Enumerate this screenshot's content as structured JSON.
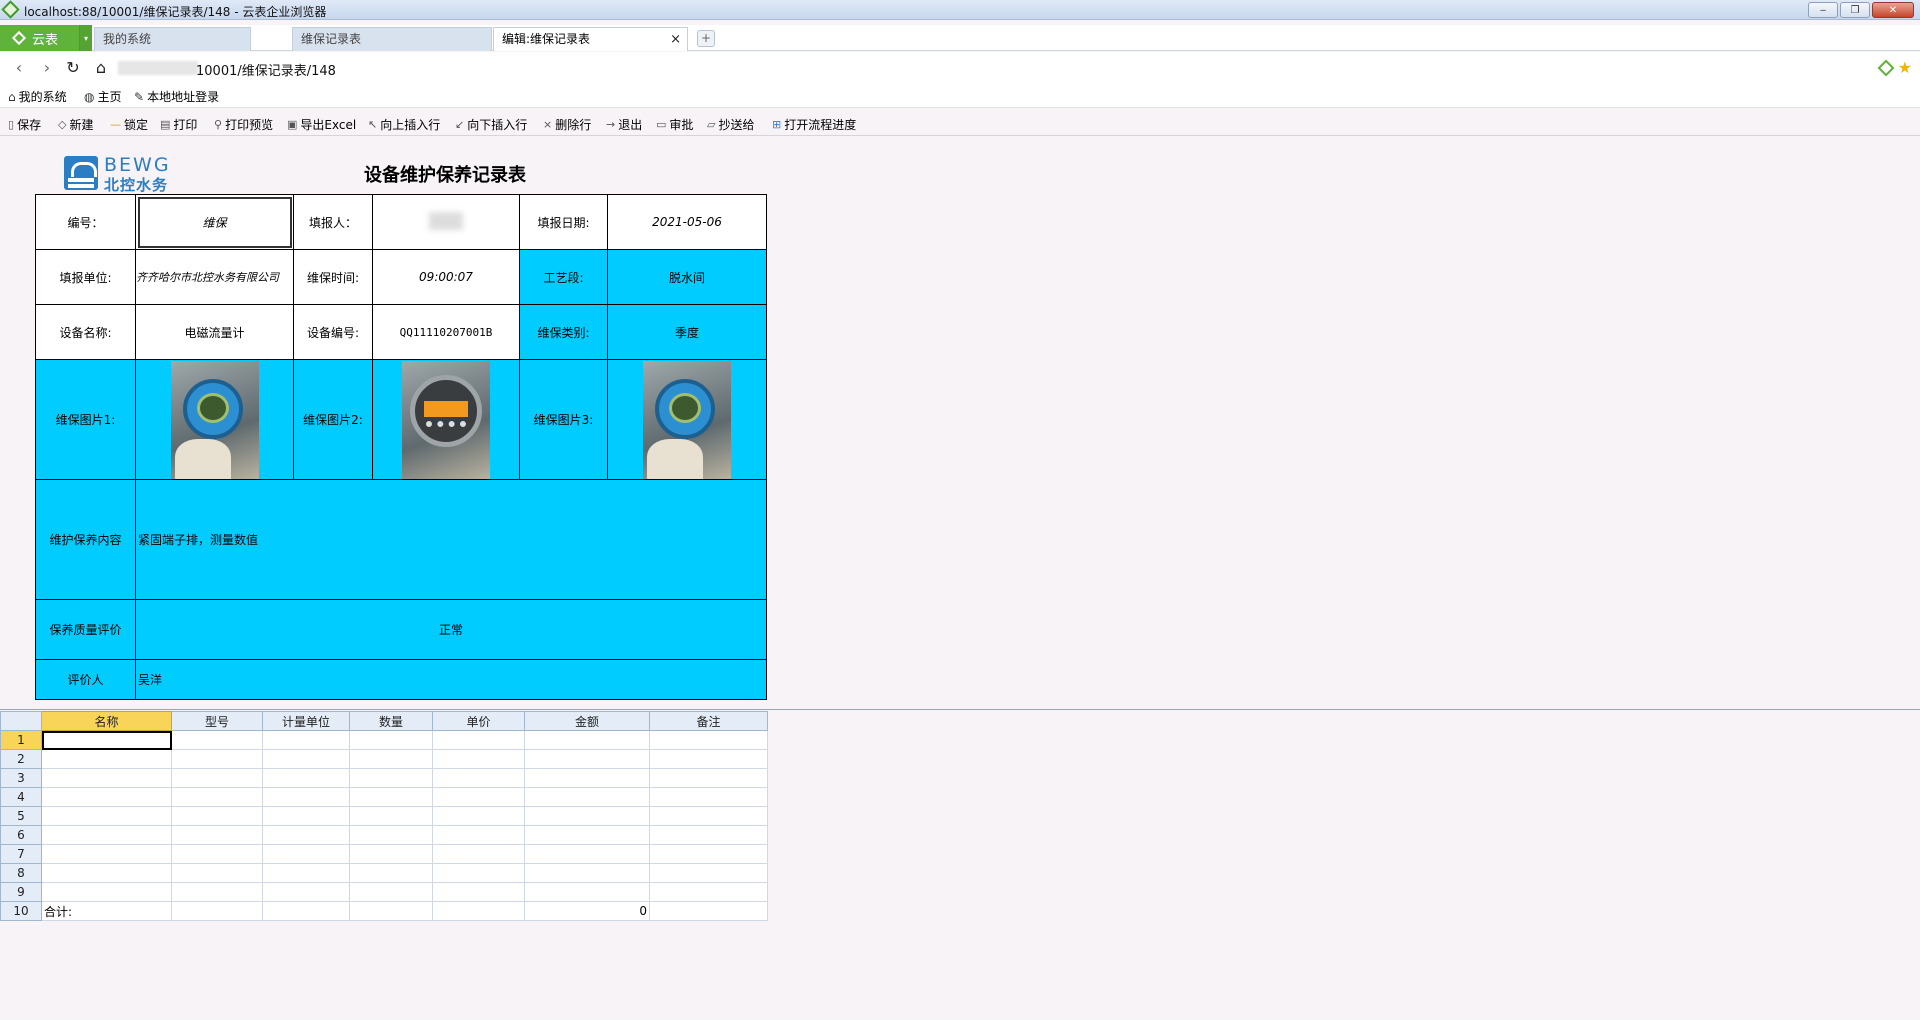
{
  "window": {
    "title": "localhost:88/10001/维保记录表/148 - 云表企业浏览器",
    "minimize": "‒",
    "restore": "❐",
    "close": "✕"
  },
  "tabs": {
    "brand": "云表",
    "brand_dropdown": "▾",
    "items": [
      {
        "label": "我的系统"
      },
      {
        "label": "维保记录表"
      },
      {
        "label": "编辑:维保记录表",
        "close": "×"
      }
    ],
    "new_tab": "+"
  },
  "address": {
    "url_visible": "10001/维保记录表/148"
  },
  "favorites": [
    {
      "label": "我的系统",
      "icon": "home-icon"
    },
    {
      "label": "主页",
      "icon": "globe-icon"
    },
    {
      "label": "本地地址登录",
      "icon": "wrench-icon"
    }
  ],
  "toolbar": [
    {
      "label": "保存",
      "icon": "save-icon"
    },
    {
      "label": "新建",
      "icon": "new-icon"
    },
    {
      "label": "锁定",
      "icon": "lock-icon"
    },
    {
      "label": "打印",
      "icon": "print-icon"
    },
    {
      "label": "打印预览",
      "icon": "print-preview-icon"
    },
    {
      "label": "导出Excel",
      "icon": "excel-icon"
    },
    {
      "label": "向上插入行",
      "icon": "insert-above-icon"
    },
    {
      "label": "向下插入行",
      "icon": "insert-below-icon"
    },
    {
      "label": "删除行",
      "icon": "delete-row-icon"
    },
    {
      "label": "退出",
      "icon": "exit-icon"
    },
    {
      "label": "审批",
      "icon": "approve-icon"
    },
    {
      "label": "抄送给",
      "icon": "cc-icon"
    },
    {
      "label": "打开流程进度",
      "icon": "flow-progress-icon"
    }
  ],
  "report": {
    "logo_en": "BEWG",
    "logo_cn": "北控水务",
    "title": "设备维护保养记录表",
    "labels": {
      "number": "编号：",
      "filler": "填报人：",
      "fill_date": "填报日期:",
      "unit": "填报单位:",
      "maint_time": "维保时间:",
      "process": "工艺段:",
      "device_name": "设备名称:",
      "device_no": "设备编号:",
      "maint_type": "维保类别:",
      "photo1": "维保图片1:",
      "photo2": "维保图片2:",
      "photo3": "维保图片3:",
      "content": "维护保养内容",
      "quality": "保养质量评价",
      "evaluator": "评价人"
    },
    "values": {
      "number": "维保",
      "fill_date": "2021-05-06",
      "unit": "齐齐哈尔市北控水务有限公司",
      "maint_time": "09:00:07",
      "process": "脱水间",
      "device_name": "电磁流量计",
      "device_no": "QQ11110207001B",
      "maint_type": "季度",
      "content": "紧固端子排，测量数值",
      "quality": "正常",
      "evaluator": "吴洋"
    }
  },
  "grid": {
    "headers": [
      "名称",
      "型号",
      "计量单位",
      "数量",
      "单价",
      "金额",
      "备注"
    ],
    "row_numbers": [
      "1",
      "2",
      "3",
      "4",
      "5",
      "6",
      "7",
      "8",
      "9",
      "10"
    ],
    "total_label": "合计:",
    "total_amount": "0"
  }
}
